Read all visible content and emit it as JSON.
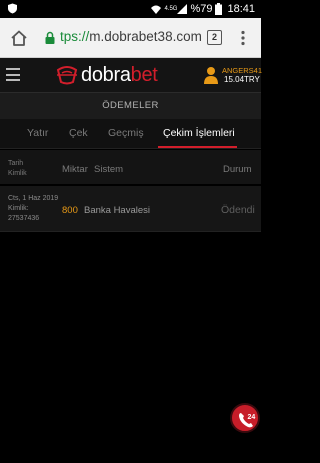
{
  "status_bar": {
    "network": "4.5G",
    "battery": "%79",
    "time": "18:41",
    "icons": [
      "notification-shield-icon",
      "wifi-signal-icon",
      "cell-signal-icon",
      "battery-icon"
    ]
  },
  "browser": {
    "url_scheme": "tps://",
    "url_host": "m.dobrabet38.com",
    "tab_count": "2",
    "icons": [
      "home-icon",
      "lock-icon",
      "more-vert-icon"
    ],
    "secure_color": "#1a8b3a"
  },
  "site_header": {
    "brand_prefix": "dobra",
    "brand_suffix": "bet",
    "username": "ANGERS41",
    "balance": "15.04TRY",
    "accent_color": "#d21e2b",
    "user_color": "#e89a17",
    "icons": [
      "hamburger-menu-icon",
      "logo-icon",
      "user-icon"
    ]
  },
  "page": {
    "title": "ÖDEMELER"
  },
  "tabs": [
    {
      "label": "Yatır",
      "active": false
    },
    {
      "label": "Çek",
      "active": false
    },
    {
      "label": "Geçmiş",
      "active": false
    },
    {
      "label": "Çekim İşlemleri",
      "active": true
    }
  ],
  "table": {
    "headers": {
      "date": "Tarih",
      "id": "Kimlik",
      "amount": "Miktar",
      "system": "Sistem",
      "status": "Durum"
    },
    "rows": [
      {
        "date": "Cts, 1 Haz 2019",
        "id_label": "Kimlik:",
        "id_value": "27537436",
        "amount": "800",
        "system": "Banka Havalesi",
        "status": "Ödendi"
      }
    ]
  },
  "support_button": {
    "icon": "support-24-icon",
    "label": "24"
  }
}
